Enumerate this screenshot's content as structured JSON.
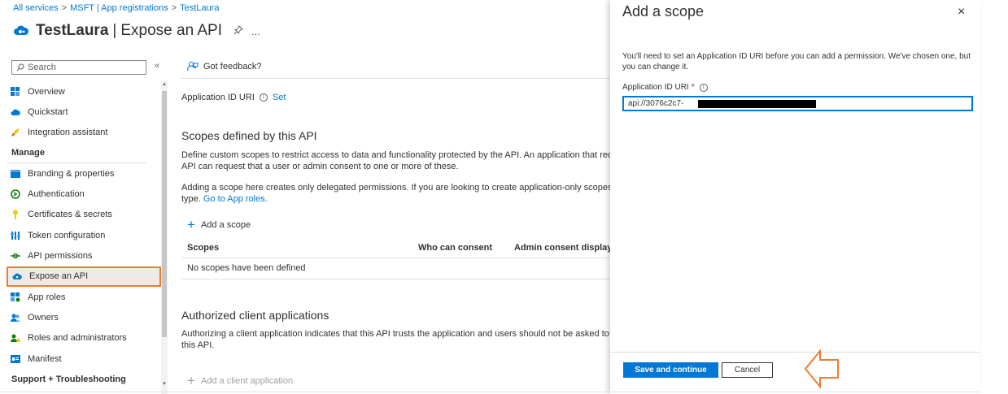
{
  "breadcrumb": {
    "items": [
      "All services",
      "MSFT | App registrations",
      "TestLaura"
    ],
    "separator": ">"
  },
  "header": {
    "app_name": "TestLaura",
    "separator": "|",
    "page_title": "Expose an API",
    "more_label": "..."
  },
  "sidebar": {
    "search_placeholder": "Search",
    "collapse_label": "«",
    "items": [
      {
        "label": "Overview",
        "icon": "grid-icon"
      },
      {
        "label": "Quickstart",
        "icon": "cloud-icon"
      },
      {
        "label": "Integration assistant",
        "icon": "rocket-icon"
      }
    ],
    "manage_title": "Manage",
    "manage_items": [
      {
        "label": "Branding & properties",
        "icon": "branding-icon"
      },
      {
        "label": "Authentication",
        "icon": "authentication-icon"
      },
      {
        "label": "Certificates & secrets",
        "icon": "key-icon"
      },
      {
        "label": "Token configuration",
        "icon": "token-icon"
      },
      {
        "label": "API permissions",
        "icon": "api-permissions-icon"
      },
      {
        "label": "Expose an API",
        "icon": "cloud-icon",
        "selected": true
      },
      {
        "label": "App roles",
        "icon": "app-roles-icon"
      },
      {
        "label": "Owners",
        "icon": "owners-icon"
      },
      {
        "label": "Roles and administrators",
        "icon": "roles-icon"
      },
      {
        "label": "Manifest",
        "icon": "manifest-icon"
      }
    ],
    "support_title": "Support + Troubleshooting"
  },
  "main": {
    "feedback_label": "Got feedback?",
    "app_id_uri_label": "Application ID URI",
    "app_id_uri_set": "Set",
    "scopes_title": "Scopes defined by this API",
    "scopes_desc_line1": "Define custom scopes to restrict access to data and functionality protected by the API. An application that requires a",
    "scopes_desc_line2": "API can request that a user or admin consent to one or more of these.",
    "scopes_note_line1": "Adding a scope here creates only delegated permissions. If you are looking to create application-only scopes, use 'Ap",
    "scopes_note_line2_prefix": "type.",
    "scopes_note_link": "Go to App roles.",
    "add_scope_label": "Add a scope",
    "table": {
      "columns": [
        "Scopes",
        "Who can consent",
        "Admin consent display ..."
      ],
      "empty_text": "No scopes have been defined"
    },
    "clients_title": "Authorized client applications",
    "clients_desc_line1": "Authorizing a client application indicates that this API trusts the application and users should not be asked to consen",
    "clients_desc_line2": "this API.",
    "add_client_label": "Add a client application"
  },
  "panel": {
    "title": "Add a scope",
    "close_label": "×",
    "description": "You'll need to set an Application ID URI before you can add a permission. We've chosen one, but you can change it.",
    "field_label": "Application ID URI",
    "required_mark": "*",
    "field_value": "api://3076c2c7-",
    "save_label": "Save and continue",
    "cancel_label": "Cancel"
  },
  "colors": {
    "accent": "#0078d4",
    "selection_outline": "#ed7d31",
    "annotation_arrow": "#ed7d31"
  }
}
